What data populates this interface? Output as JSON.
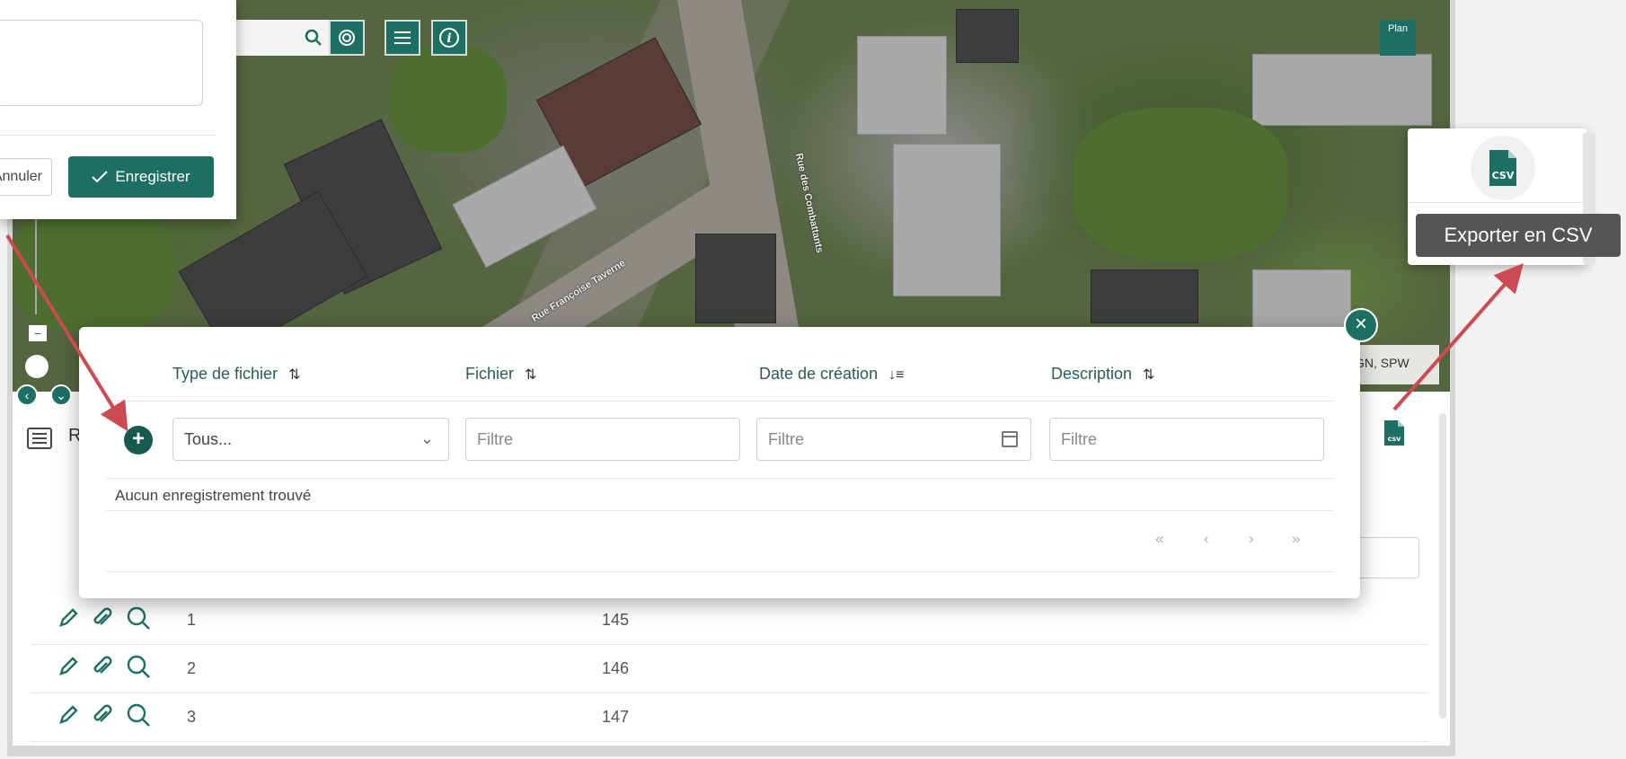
{
  "map": {
    "street_labels": [
      "Rue des Combattants",
      "Rue Françoise Taverne"
    ],
    "base_layer_label": "Plan",
    "attribution": "GN, SPW"
  },
  "dialog": {
    "cancel_label": "Annuler",
    "save_label": "Enregistrer"
  },
  "records": {
    "title": "R",
    "rows": [
      {
        "id": "1",
        "value": "145"
      },
      {
        "id": "2",
        "value": "146"
      },
      {
        "id": "3",
        "value": "147"
      }
    ]
  },
  "file_modal": {
    "columns": [
      {
        "label": "Type de fichier",
        "sort": "⇅"
      },
      {
        "label": "Fichier",
        "sort": "⇅"
      },
      {
        "label": "Date de création",
        "sort": "↓≡"
      },
      {
        "label": "Description",
        "sort": "⇅"
      }
    ],
    "filters": {
      "type_selected": "Tous...",
      "file_placeholder": "Filtre",
      "date_placeholder": "Filtre",
      "description_placeholder": "Filtre"
    },
    "empty_message": "Aucun enregistrement trouvé",
    "pager": [
      "«",
      "‹",
      "›",
      "»"
    ]
  },
  "csv_export": {
    "icon_text": "CSV",
    "small_icon_text": "csv",
    "tooltip": "Exporter en CSV"
  },
  "colors": {
    "accent": "#1e6f63",
    "arrow": "#cc4a52"
  }
}
